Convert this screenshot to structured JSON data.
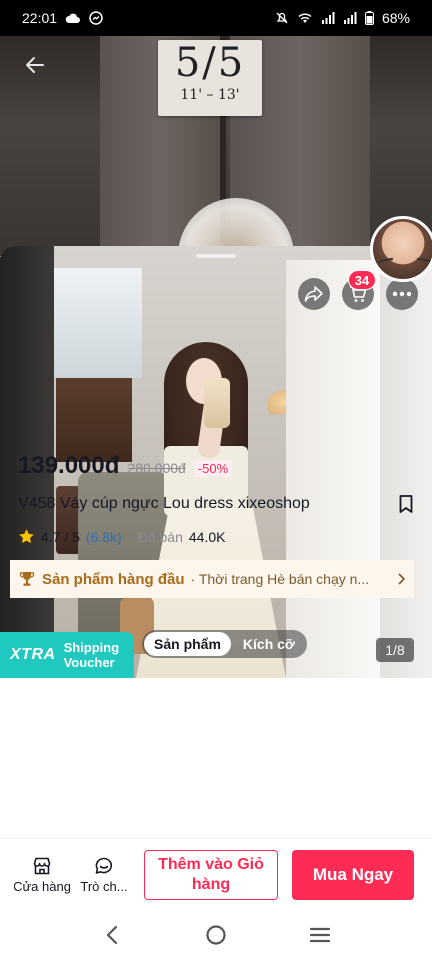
{
  "status_bar": {
    "time": "22:01",
    "battery": "68%"
  },
  "product": {
    "price": "139.000đ",
    "original_price": "280.000đ",
    "discount": "-50%",
    "title": "V458 Váy cúp ngực Lou dress xixeoshop",
    "rating": "4.7 / 5",
    "review_count": "(6.8k)",
    "sold_label": "Đã bán",
    "sold_value": "44.0K"
  },
  "gallery": {
    "tabs": [
      {
        "label": "Sản phẩm",
        "active": true
      },
      {
        "label": "Kích cỡ",
        "active": false
      }
    ],
    "image_counter": "1/8",
    "cart_badge": "34"
  },
  "background_sign": {
    "top": "5/5",
    "bottom": "11' – 13'"
  },
  "promo": {
    "xtra_label": "XTRA",
    "xtra_text_line1": "Shipping",
    "xtra_text_line2": "Voucher"
  },
  "bestseller": {
    "label": "Sản phẩm hàng đầu",
    "detail": "· Thời trang Hè bán chạy n..."
  },
  "actions": {
    "shop_label": "Cửa hàng",
    "chat_label": "Trò ch...",
    "add_to_cart": "Thêm vào Giỏ hàng",
    "buy_now": "Mua Ngay"
  },
  "colors": {
    "accent": "#fe2c55",
    "xtra_teal": "#20c9c0",
    "bestseller_gold": "#a86b1c"
  },
  "icons": {
    "back": "arrow-left-icon",
    "share": "share-icon",
    "cart": "cart-icon",
    "more": "more-icon",
    "star": "star-icon",
    "trophy": "trophy-icon",
    "chevron": "chevron-right-icon",
    "bookmark": "bookmark-icon",
    "shop": "shop-icon",
    "chat": "chat-icon"
  }
}
